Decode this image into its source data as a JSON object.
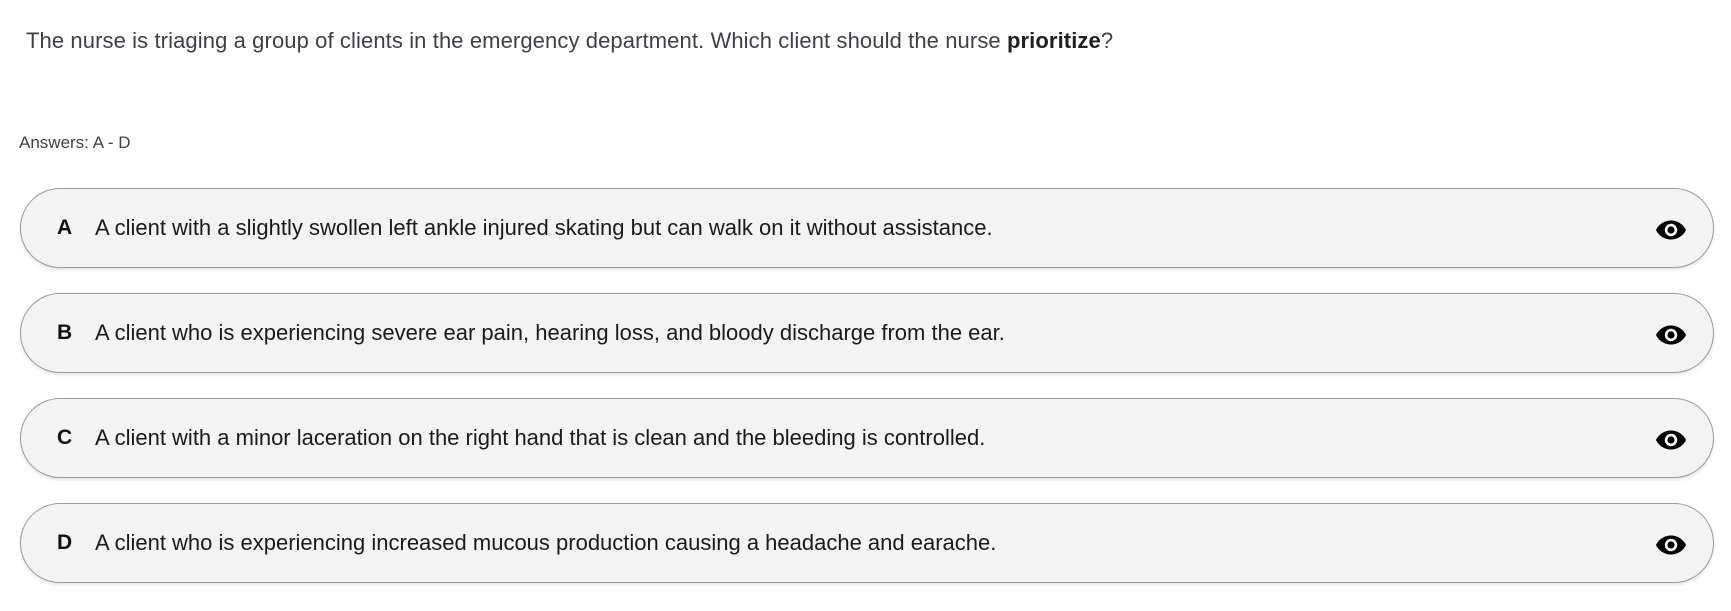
{
  "question": {
    "text_before": "The nurse is triaging a group of clients in the emergency department. Which client should the nurse ",
    "emphasis": "prioritize",
    "text_after": "?"
  },
  "answers_label": "Answers: A - D",
  "options": [
    {
      "letter": "A",
      "text": "A client with a slightly swollen left ankle injured skating but can walk on it without assistance.",
      "icon": "eye-icon"
    },
    {
      "letter": "B",
      "text": "A client who is experiencing severe ear pain, hearing loss, and bloody discharge from the ear.",
      "icon": "eye-icon"
    },
    {
      "letter": "C",
      "text": "A client with a minor laceration on the right hand that is clean and the bleeding is controlled.",
      "icon": "eye-icon"
    },
    {
      "letter": "D",
      "text": "A client who is experiencing increased mucous production causing a headache and earache.",
      "icon": "eye-icon"
    }
  ],
  "colors": {
    "option_background": "#f3f3f3",
    "option_border": "#9a9a9a",
    "text": "#1a1a1a",
    "question_text": "#3d4047"
  }
}
